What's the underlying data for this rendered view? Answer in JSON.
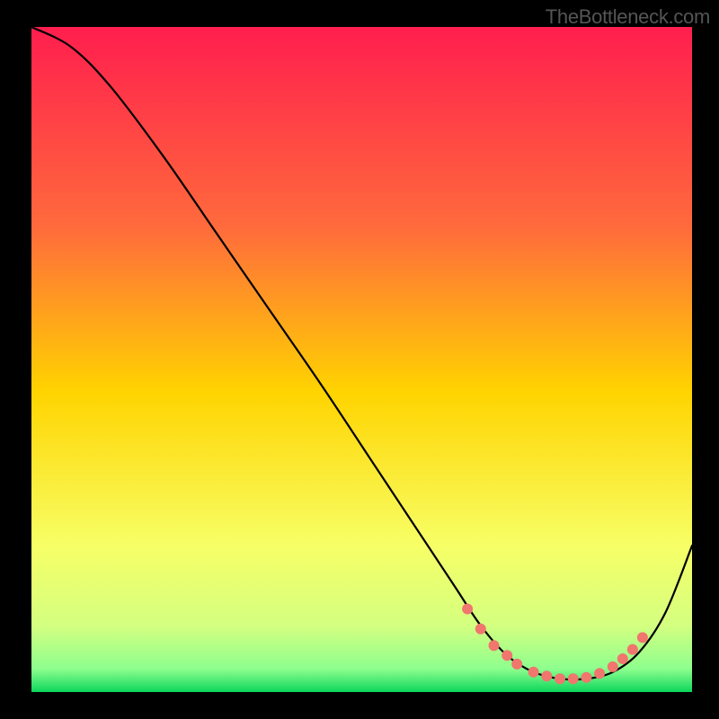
{
  "watermark": "TheBottleneck.com",
  "chart_data": {
    "type": "line",
    "title": "",
    "xlabel": "",
    "ylabel": "",
    "xlim": [
      0,
      100
    ],
    "ylim": [
      0,
      100
    ],
    "grid": false,
    "gradient_stops": [
      {
        "offset": 0.0,
        "color": "#ff1e4e"
      },
      {
        "offset": 0.3,
        "color": "#ff6a3c"
      },
      {
        "offset": 0.55,
        "color": "#ffd400"
      },
      {
        "offset": 0.78,
        "color": "#f7ff66"
      },
      {
        "offset": 0.9,
        "color": "#d4ff80"
      },
      {
        "offset": 0.965,
        "color": "#8eff8e"
      },
      {
        "offset": 1.0,
        "color": "#0cd65b"
      }
    ],
    "curve": {
      "x": [
        0,
        6,
        12,
        20,
        28,
        36,
        44,
        52,
        58,
        64,
        68,
        72,
        76,
        80,
        84,
        88,
        92,
        96,
        100
      ],
      "y": [
        100,
        97,
        91,
        80.5,
        69,
        57.5,
        46,
        34,
        25,
        16,
        10,
        5.5,
        3,
        2,
        2,
        3,
        6,
        12,
        22
      ]
    },
    "markers": {
      "x": [
        66,
        68,
        70,
        72,
        73.5,
        76,
        78,
        80,
        82,
        84,
        86,
        88,
        89.5,
        91,
        92.5
      ],
      "y": [
        12.5,
        9.5,
        7,
        5.5,
        4.2,
        3,
        2.4,
        2,
        2,
        2.2,
        2.8,
        3.8,
        5,
        6.4,
        8.2
      ],
      "color": "#f0766e",
      "r": 6
    }
  }
}
